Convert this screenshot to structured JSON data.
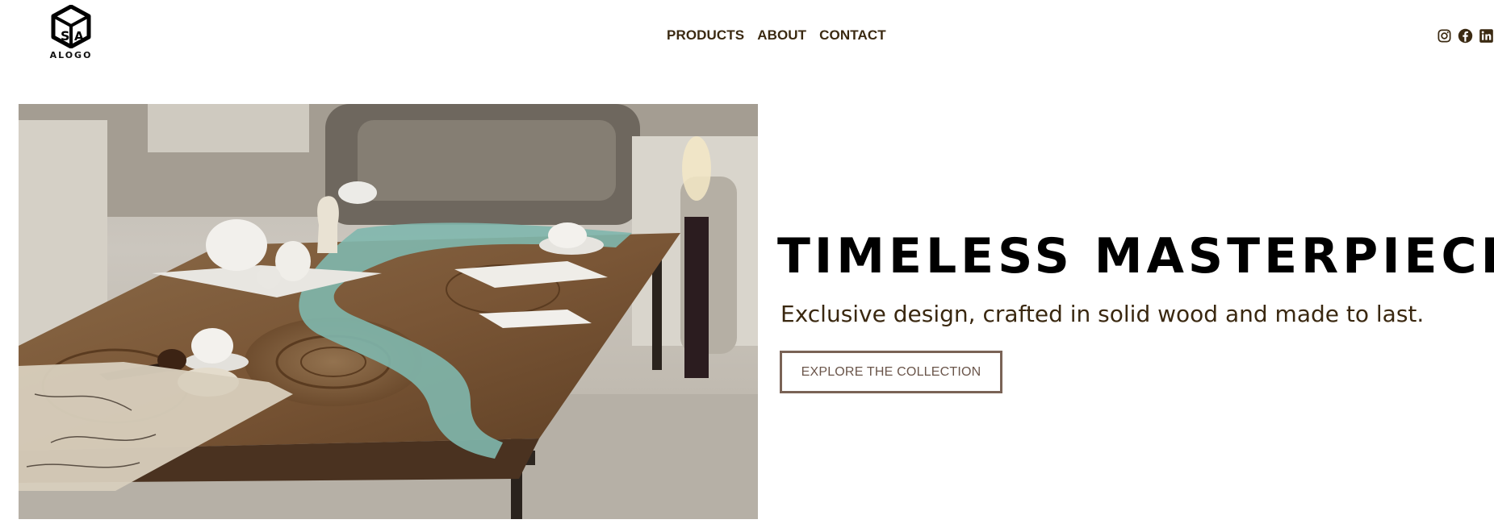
{
  "header": {
    "logo_text": "ALOGO",
    "logo_icon": "cube-logo-icon",
    "nav": [
      {
        "label": "PRODUCTS"
      },
      {
        "label": "ABOUT"
      },
      {
        "label": "CONTACT"
      }
    ],
    "social": [
      {
        "icon": "instagram-icon"
      },
      {
        "icon": "facebook-icon"
      },
      {
        "icon": "linkedin-icon"
      }
    ]
  },
  "hero": {
    "headline": "TIMELESS MASTERPIECES",
    "subline": "Exclusive design, crafted in solid wood and made to last.",
    "cta_label": "EXPLORE THE COLLECTION"
  },
  "colors": {
    "nav_text": "#3b2a12",
    "subline_text": "#3a2810",
    "cta_border": "#7a6356",
    "cta_text": "#6a554a"
  }
}
